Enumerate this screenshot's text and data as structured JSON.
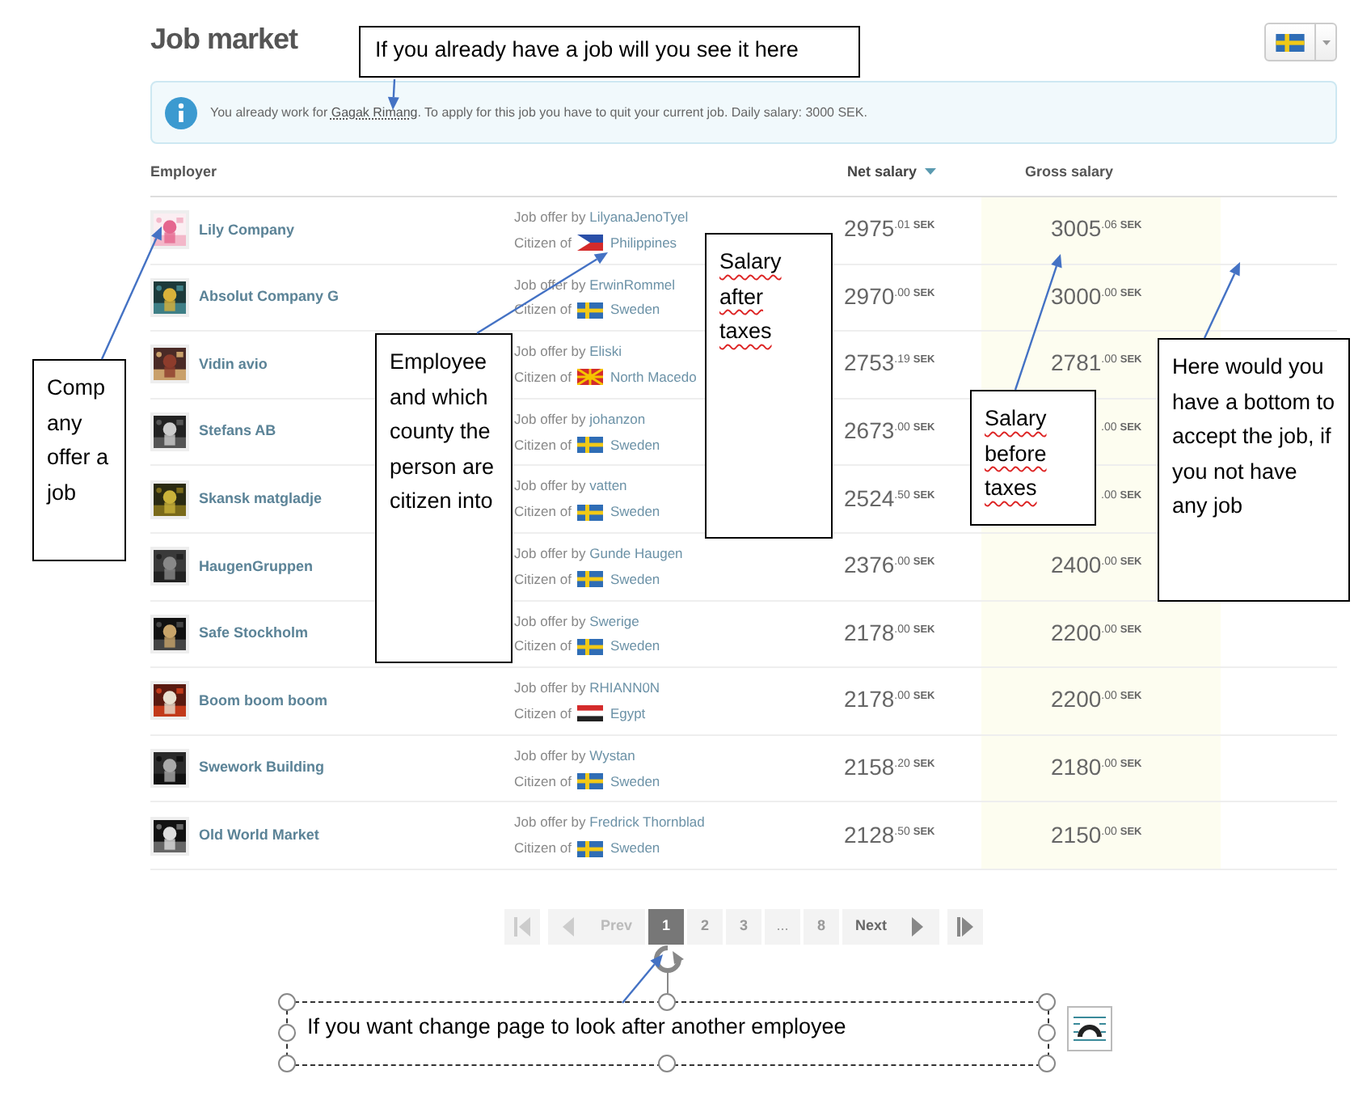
{
  "page_title": "Job market",
  "notice": {
    "text": "You already work for",
    "link": "Gagak Rimang",
    "rest": ". To apply for this job you have to quit your current job. Daily salary: 3000 SEK."
  },
  "columns": [
    {
      "label": "Employer",
      "sorted": false
    },
    {
      "label": "Net salary",
      "sorted": true
    },
    {
      "label": "Gross salary",
      "sorted": false
    }
  ],
  "rows": [
    {
      "kind": "ph",
      "company": "Lily Company",
      "offer_prefix": "Job offer by",
      "employee": "LilyanaJenoTyel",
      "citizen_prefix": "Citizen of",
      "country": "Philippines",
      "net": {
        "whole": "2975",
        "cents": ".01",
        "unit": "SEK"
      },
      "gross": {
        "whole": "3005",
        "cents": ".06",
        "unit": "SEK"
      }
    },
    {
      "kind": "se",
      "company": "Absolut Company G",
      "offer_prefix": "Job offer by",
      "employee": "ErwinRommel",
      "citizen_prefix": "Citizen of",
      "country": "Sweden",
      "net": {
        "whole": "2970",
        "cents": ".00",
        "unit": "SEK"
      },
      "gross": {
        "whole": "3000",
        "cents": ".00",
        "unit": "SEK"
      }
    },
    {
      "kind": "mk",
      "company": "Vidin avio",
      "offer_prefix": "Job offer by",
      "employee": "Eliski",
      "citizen_prefix": "Citizen of",
      "country": "North Macedo",
      "net": {
        "whole": "2753",
        "cents": ".19",
        "unit": "SEK"
      },
      "gross": {
        "whole": "2781",
        "cents": ".00",
        "unit": "SEK"
      }
    },
    {
      "kind": "se",
      "company": "Stefans AB",
      "offer_prefix": "Job offer by",
      "employee": "johanzon",
      "citizen_prefix": "Citizen of",
      "country": "Sweden",
      "net": {
        "whole": "2673",
        "cents": ".00",
        "unit": "SEK"
      },
      "gross": {
        "cents": ".00",
        "unit": "SEK"
      }
    },
    {
      "kind": "se",
      "company": "Skansk matgladje",
      "offer_prefix": "Job offer by",
      "employee": "vatten",
      "citizen_prefix": "Citizen of",
      "country": "Sweden",
      "net": {
        "whole": "2524",
        "cents": ".50",
        "unit": "SEK"
      },
      "gross": {
        "cents": ".00",
        "unit": "SEK"
      }
    },
    {
      "kind": "se",
      "company": "HaugenGruppen",
      "offer_prefix": "Job offer by",
      "employee": "Gunde Haugen",
      "citizen_prefix": "Citizen of",
      "country": "Sweden",
      "net": {
        "whole": "2376",
        "cents": ".00",
        "unit": "SEK"
      },
      "gross": {
        "whole": "2400",
        "cents": ".00",
        "unit": "SEK"
      }
    },
    {
      "kind": "se",
      "company": "Safe Stockholm",
      "offer_prefix": "Job offer by",
      "employee": "Swerige",
      "citizen_prefix": "Citizen of",
      "country": "Sweden",
      "net": {
        "whole": "2178",
        "cents": ".00",
        "unit": "SEK"
      },
      "gross": {
        "whole": "2200",
        "cents": ".00",
        "unit": "SEK"
      }
    },
    {
      "kind": "eg",
      "company": "Boom boom boom",
      "offer_prefix": "Job offer by",
      "employee": "RHIANN0N",
      "citizen_prefix": "Citizen of",
      "country": "Egypt",
      "net": {
        "whole": "2178",
        "cents": ".00",
        "unit": "SEK"
      },
      "gross": {
        "whole": "2200",
        "cents": ".00",
        "unit": "SEK"
      }
    },
    {
      "kind": "se",
      "company": "Swework Building",
      "offer_prefix": "Job offer by",
      "employee": "Wystan",
      "citizen_prefix": "Citizen of",
      "country": "Sweden",
      "net": {
        "whole": "2158",
        "cents": ".20",
        "unit": "SEK"
      },
      "gross": {
        "whole": "2180",
        "cents": ".00",
        "unit": "SEK"
      }
    },
    {
      "kind": "se",
      "company": "Old World Market",
      "offer_prefix": "Job offer by",
      "employee": "Fredrick Thornblad",
      "citizen_prefix": "Citizen of",
      "country": "Sweden",
      "net": {
        "whole": "2128",
        "cents": ".50",
        "unit": "SEK"
      },
      "gross": {
        "whole": "2150",
        "cents": ".00",
        "unit": "SEK"
      }
    }
  ],
  "pagination": [
    {
      "kind": "first",
      "selected": false
    },
    {
      "kind": "prev",
      "label": "Prev",
      "selected": false
    },
    {
      "kind": "page",
      "label": "1",
      "selected": true
    },
    {
      "kind": "page",
      "label": "2",
      "selected": false
    },
    {
      "kind": "page",
      "label": "3",
      "selected": false
    },
    {
      "kind": "ellipsis",
      "label": "...",
      "selected": false
    },
    {
      "kind": "page",
      "label": "8",
      "selected": false
    },
    {
      "kind": "next",
      "label": "Next",
      "selected": false
    },
    {
      "kind": "last",
      "selected": false
    }
  ],
  "annotations": [
    {
      "text": "If you already have a job will you see it here",
      "spellcheck": false,
      "selected": false
    },
    {
      "text": "Company offer a job",
      "spellcheck": false,
      "selected": false
    },
    {
      "text": "Employee and which county the person are citizen into",
      "spellcheck": false,
      "selected": false
    },
    {
      "text": "Salary after taxes",
      "spellcheck": true,
      "selected": false
    },
    {
      "text": "Salary before taxes",
      "spellcheck": true,
      "selected": false
    },
    {
      "text": "Here would you have a bottom to accept the job, if you not have any job",
      "spellcheck": false,
      "selected": false
    },
    {
      "text": "If you want change page to look after another employee",
      "spellcheck": false,
      "selected": true
    }
  ]
}
